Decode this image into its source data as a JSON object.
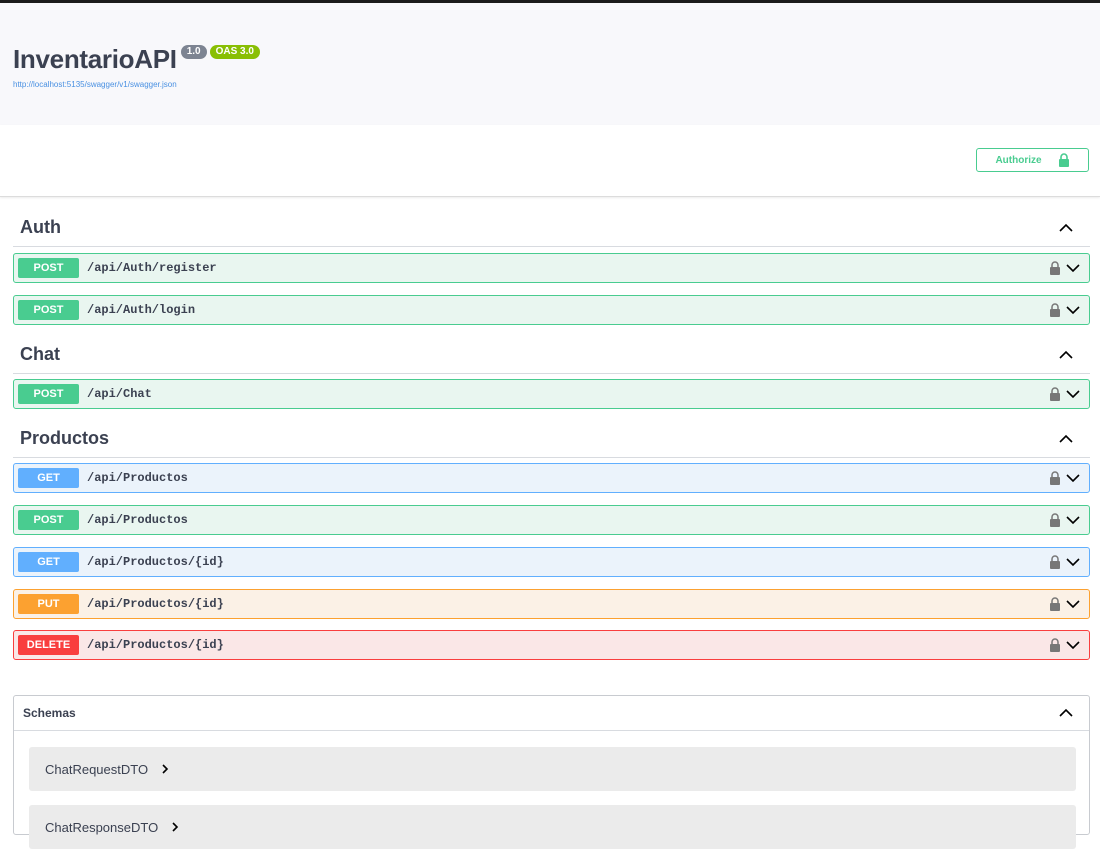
{
  "info": {
    "title": "InventarioAPI",
    "version": "1.0",
    "oas": "OAS 3.0",
    "spec_url": "http://localhost:5135/swagger/v1/swagger.json"
  },
  "authorize_label": "Authorize",
  "colors": {
    "post": "#49cc90",
    "get": "#61affe",
    "put": "#fca130",
    "delete": "#f93e3e"
  },
  "tags": [
    {
      "name": "Auth",
      "operations": [
        {
          "method": "POST",
          "path": "/api/Auth/register"
        },
        {
          "method": "POST",
          "path": "/api/Auth/login"
        }
      ]
    },
    {
      "name": "Chat",
      "operations": [
        {
          "method": "POST",
          "path": "/api/Chat"
        }
      ]
    },
    {
      "name": "Productos",
      "operations": [
        {
          "method": "GET",
          "path": "/api/Productos"
        },
        {
          "method": "POST",
          "path": "/api/Productos"
        },
        {
          "method": "GET",
          "path": "/api/Productos/{id}"
        },
        {
          "method": "PUT",
          "path": "/api/Productos/{id}"
        },
        {
          "method": "DELETE",
          "path": "/api/Productos/{id}"
        }
      ]
    }
  ],
  "schemas": {
    "title": "Schemas",
    "models": [
      "ChatRequestDTO",
      "ChatResponseDTO"
    ]
  },
  "icons": {
    "tag_toggle": "chevron-up-icon",
    "operation_lock": "lock-icon",
    "operation_toggle": "chevron-down-icon",
    "model_expand": "chevron-right-icon",
    "authorize": "lock-icon"
  }
}
